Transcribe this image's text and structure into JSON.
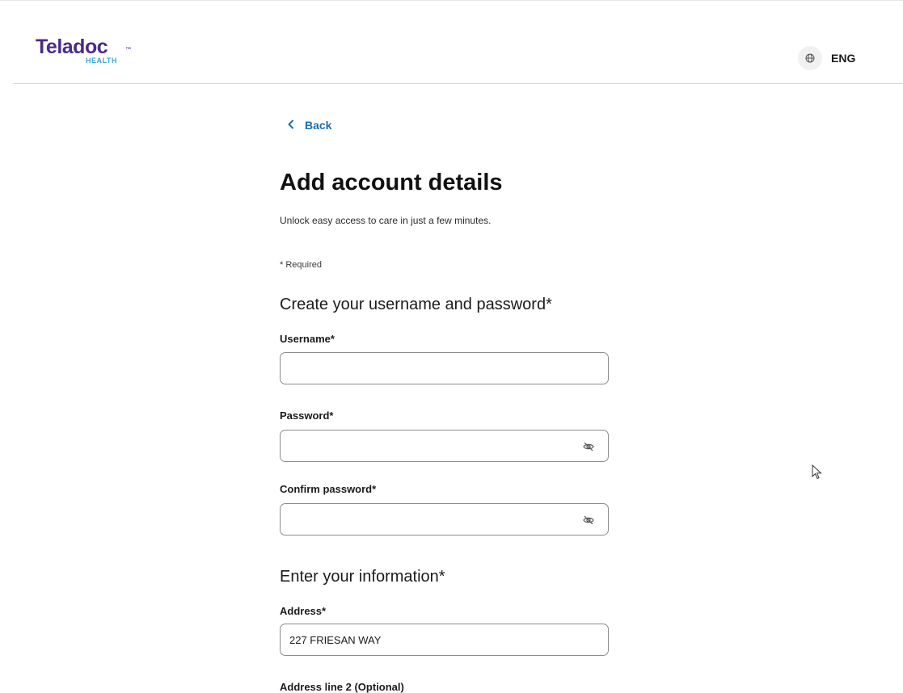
{
  "brand": {
    "name": "Teladoc",
    "tm": "™",
    "sub": "HEALTH",
    "primary_color": "#4a2a8a",
    "accent_color": "#3aa7d7"
  },
  "header": {
    "language_icon": "globe-icon",
    "language_label": "ENG"
  },
  "nav": {
    "back_icon": "chevron-left-icon",
    "back_label": "Back",
    "link_color": "#1a6fb0"
  },
  "page": {
    "title": "Add account details",
    "subtitle": "Unlock easy access to care in just a few minutes.",
    "required_note": "* Required"
  },
  "credentials": {
    "section_title": "Create your username and password*",
    "username": {
      "label": "Username*",
      "value": "",
      "placeholder": ""
    },
    "password": {
      "label": "Password*",
      "value": "",
      "placeholder": "",
      "toggle_icon": "eye-slash-icon"
    },
    "confirm_password": {
      "label": "Confirm password*",
      "value": "",
      "placeholder": "",
      "toggle_icon": "eye-slash-icon"
    }
  },
  "information": {
    "section_title": "Enter your information*",
    "address": {
      "label": "Address*",
      "value": "227 FRIESAN WAY"
    },
    "address2": {
      "label": "Address line 2 (Optional)"
    }
  }
}
